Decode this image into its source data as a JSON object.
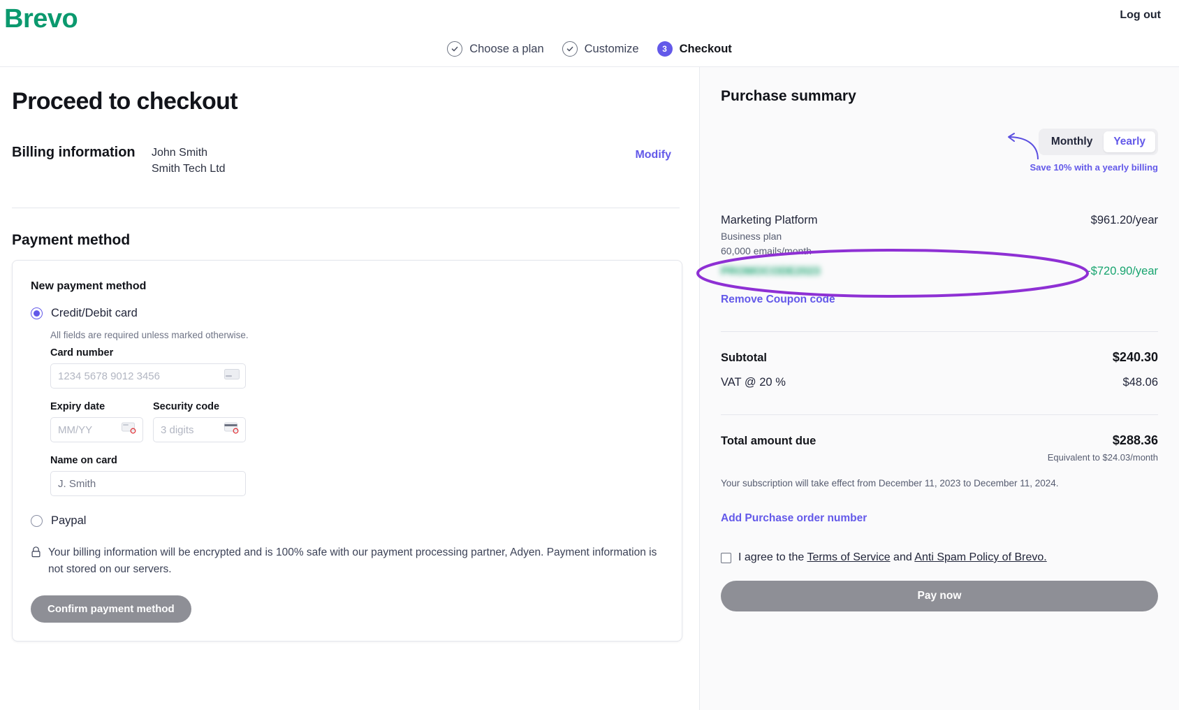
{
  "brand": {
    "logo_text": "Brevo",
    "logo_color": "#0b996e",
    "accent": "#6359e9",
    "success": "#18a46f",
    "annotation_color": "#8e30d4"
  },
  "header": {
    "logout_label": "Log out",
    "steps": [
      {
        "label": "Choose a plan",
        "state": "done",
        "badge": "check-icon"
      },
      {
        "label": "Customize",
        "state": "done",
        "badge": "check-icon"
      },
      {
        "label": "Checkout",
        "state": "current",
        "badge": "3"
      }
    ]
  },
  "left": {
    "page_title": "Proceed to checkout",
    "billing": {
      "label": "Billing information",
      "name": "John Smith",
      "company": "Smith Tech Ltd",
      "modify_label": "Modify"
    },
    "payment_section_title": "Payment method",
    "card": {
      "heading": "New payment method",
      "option_card_label": "Credit/Debit card",
      "option_paypal_label": "Paypal",
      "required_hint": "All fields are required unless marked otherwise.",
      "card_number_label": "Card number",
      "card_number_placeholder": "1234 5678 9012 3456",
      "expiry_label": "Expiry date",
      "expiry_placeholder": "MM/YY",
      "security_label": "Security code",
      "security_placeholder": "3 digits",
      "name_label": "Name on card",
      "name_placeholder": "J. Smith",
      "notice": "Your billing information will be encrypted and is 100% safe with our payment processing partner, Adyen. Payment information is not stored on our servers.",
      "confirm_label": "Confirm payment method"
    }
  },
  "right": {
    "title": "Purchase summary",
    "billing_cycle": {
      "monthly_label": "Monthly",
      "yearly_label": "Yearly",
      "selected": "Yearly",
      "save_note": "Save 10% with a yearly billing"
    },
    "plan": {
      "name": "Marketing Platform",
      "tier": "Business plan",
      "volume": "60,000 emails/month",
      "price": "$961.20/year"
    },
    "coupon": {
      "code": "PROMOCODE2023",
      "code_blurred": true,
      "amount": "-$720.90/year",
      "remove_label": "Remove Coupon code"
    },
    "totals": {
      "subtotal_label": "Subtotal",
      "subtotal_value": "$240.30",
      "vat_label": "VAT @ 20 %",
      "vat_value": "$48.06",
      "total_label": "Total amount due",
      "total_value": "$288.36",
      "equivalent": "Equivalent to $24.03/month"
    },
    "effect_note": "Your subscription will take effect from December 11, 2023 to December 11, 2024.",
    "purchase_order_label": "Add Purchase order number",
    "agree": {
      "prefix": "I agree to the ",
      "terms_link": "Terms of Service",
      "middle": " and ",
      "spam_link": "Anti Spam Policy of Brevo.",
      "checked": false
    },
    "pay_label": "Pay now"
  }
}
